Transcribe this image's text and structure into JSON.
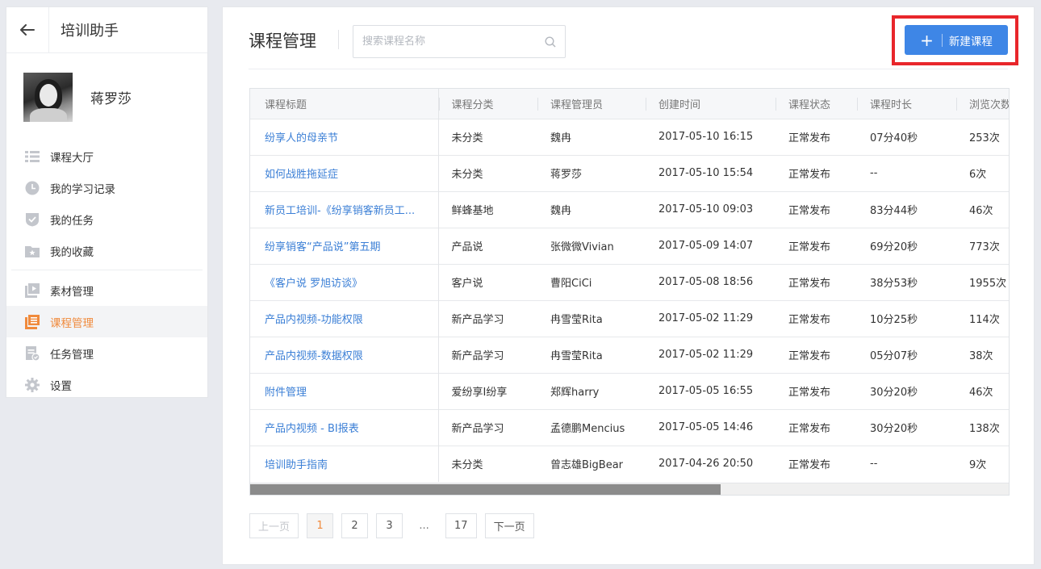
{
  "sidebar": {
    "title": "培训助手",
    "username": "蒋罗莎",
    "items": [
      {
        "label": "课程大厅",
        "icon": "list-icon"
      },
      {
        "label": "我的学习记录",
        "icon": "clock-icon"
      },
      {
        "label": "我的任务",
        "icon": "check-shield-icon"
      },
      {
        "label": "我的收藏",
        "icon": "star-folder-icon"
      },
      {
        "label": "素材管理",
        "icon": "media-icon"
      },
      {
        "label": "课程管理",
        "icon": "course-icon"
      },
      {
        "label": "任务管理",
        "icon": "task-doc-icon"
      },
      {
        "label": "设置",
        "icon": "gear-icon"
      }
    ],
    "active_item": "课程管理"
  },
  "header": {
    "title": "课程管理",
    "search_placeholder": "搜索课程名称",
    "new_button": "新建课程"
  },
  "table": {
    "columns": [
      "课程标题",
      "课程分类",
      "课程管理员",
      "创建时间",
      "课程状态",
      "课程时长",
      "浏览次数"
    ],
    "rows": [
      [
        "纷享人的母亲节",
        "未分类",
        "魏冉",
        "2017-05-10 16:15",
        "正常发布",
        "07分40秒",
        "253次"
      ],
      [
        "如何战胜拖延症",
        "未分类",
        "蒋罗莎",
        "2017-05-10 15:54",
        "正常发布",
        "--",
        "6次"
      ],
      [
        "新员工培训-《纷享销客新员工...",
        "鲜蜂基地",
        "魏冉",
        "2017-05-10 09:03",
        "正常发布",
        "83分44秒",
        "46次"
      ],
      [
        "纷享销客“产品说”第五期",
        "产品说",
        "张微微Vivian",
        "2017-05-09 14:07",
        "正常发布",
        "69分20秒",
        "773次"
      ],
      [
        "《客户说 罗旭访谈》",
        "客户说",
        "曹阳CiCi",
        "2017-05-08 18:56",
        "正常发布",
        "38分53秒",
        "1955次"
      ],
      [
        "产品内视频-功能权限",
        "新产品学习",
        "冉雪莹Rita",
        "2017-05-02 11:29",
        "正常发布",
        "10分25秒",
        "114次"
      ],
      [
        "产品内视频-数据权限",
        "新产品学习",
        "冉雪莹Rita",
        "2017-05-02 11:29",
        "正常发布",
        "05分07秒",
        "38次"
      ],
      [
        "附件管理",
        "爱纷享I纷享",
        "郑辉harry",
        "2017-05-05 16:55",
        "正常发布",
        "30分20秒",
        "46次"
      ],
      [
        "产品内视频 - BI报表",
        "新产品学习",
        "孟德鹏Mencius",
        "2017-05-05 14:46",
        "正常发布",
        "30分20秒",
        "138次"
      ],
      [
        "培训助手指南",
        "未分类",
        "曾志雄BigBear",
        "2017-04-26 20:50",
        "正常发布",
        "--",
        "9次"
      ]
    ]
  },
  "pagination": {
    "prev": "上一页",
    "pages": [
      "1",
      "2",
      "3"
    ],
    "ellipsis": "...",
    "last": "17",
    "next": "下一页",
    "current": "1"
  },
  "colors": {
    "accent_orange": "#f08a3c",
    "primary_blue": "#3e86e6",
    "link_blue": "#3b7fd6",
    "highlight_red": "#e8262b"
  }
}
